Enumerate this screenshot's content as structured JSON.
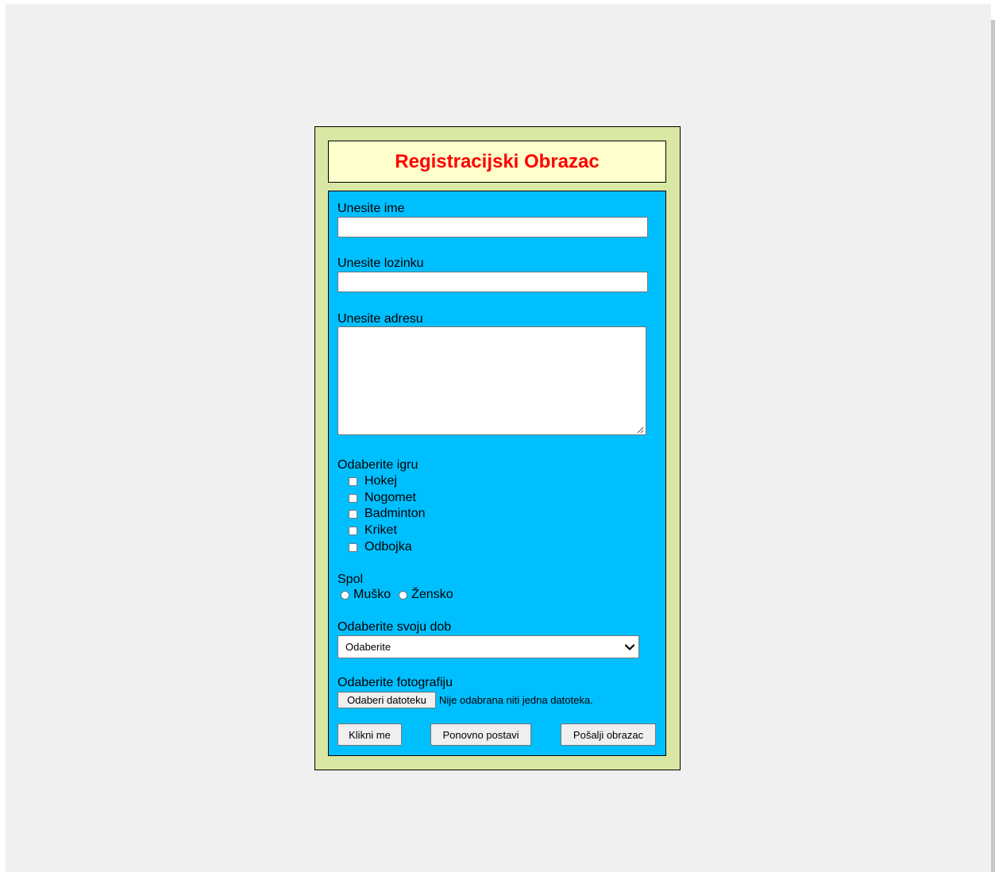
{
  "form": {
    "title": "Registracijski Obrazac",
    "name_label": "Unesite ime",
    "name_value": "",
    "password_label": "Unesite lozinku",
    "password_value": "",
    "address_label": "Unesite adresu",
    "address_value": "",
    "games_label": "Odaberite igru",
    "games": [
      {
        "label": "Hokej",
        "checked": false
      },
      {
        "label": "Nogomet",
        "checked": false
      },
      {
        "label": "Badminton",
        "checked": false
      },
      {
        "label": "Kriket",
        "checked": false
      },
      {
        "label": "Odbojka",
        "checked": false
      }
    ],
    "gender_label": "Spol",
    "genders": [
      {
        "label": "Muško",
        "selected": false
      },
      {
        "label": "Žensko",
        "selected": false
      }
    ],
    "age_label": "Odaberite svoju dob",
    "age_selected": "Odaberite",
    "photo_label": "Odaberite fotografiju",
    "file_button": "Odaberi datoteku",
    "file_status": "Nije odabrana niti jedna datoteka.",
    "buttons": {
      "click": "Klikni me",
      "reset": "Ponovno postavi",
      "submit": "Pošalji obrazac"
    }
  },
  "colors": {
    "page_background": "#f0f0f0",
    "outer_background": "#d8e8a4",
    "header_background": "#ffffcc",
    "title_color": "#ff0000",
    "form_background": "#00bfff"
  }
}
